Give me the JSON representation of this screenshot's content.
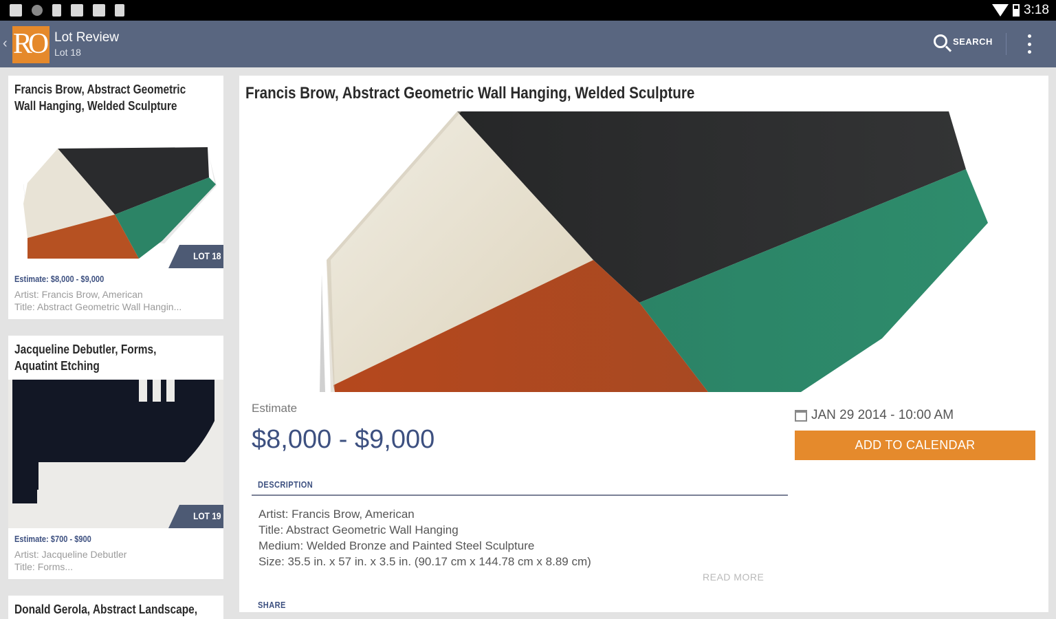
{
  "status_bar": {
    "time": "3:18"
  },
  "action_bar": {
    "logo_text": "RO",
    "title": "Lot Review",
    "subtitle": "Lot 18",
    "search_label": "SEARCH"
  },
  "lots": [
    {
      "title_line1": "Francis Brow, Abstract Geometric",
      "title_line2": "Wall Hanging, Welded Sculpture",
      "badge": "LOT 18",
      "estimate": "Estimate: $8,000 - $9,000",
      "artist": "Artist:  Francis Brow, American",
      "title_meta": "Title:  Abstract Geometric Wall Hangin..."
    },
    {
      "title_line1": "Jacqueline Debutler, Forms,",
      "title_line2": "Aquatint Etching",
      "badge": "LOT 19",
      "estimate": "Estimate: $700 - $900",
      "artist": "Artist:  Jacqueline Debutler",
      "title_meta": "Title:  Forms..."
    },
    {
      "title_line1": "Donald Gerola, Abstract Landscape,"
    }
  ],
  "detail": {
    "title": "Francis Brow, Abstract Geometric Wall Hanging, Welded Sculpture",
    "estimate_label": "Estimate",
    "estimate_value": "$8,000 - $9,000",
    "description_heading": "DESCRIPTION",
    "description_lines": [
      "Artist:  Francis Brow, American",
      "Title:  Abstract Geometric Wall Hanging",
      "Medium:  Welded Bronze and Painted Steel Sculpture",
      "Size:  35.5 in. x 57 in. x 3.5 in. (90.17 cm x 144.78 cm x 8.89 cm)"
    ],
    "read_more": "READ MORE",
    "share_heading": "SHARE",
    "date": "JAN 29 2014 - 10:00 AM",
    "calendar_button": "ADD TO CALENDAR"
  },
  "colors": {
    "action_bar": "#596680",
    "accent_orange": "#e5892b",
    "price_blue": "#3d5080"
  },
  "icons": [
    "back-chevron-icon",
    "search-icon",
    "overflow-menu-icon",
    "calendar-icon",
    "wifi-icon",
    "battery-icon"
  ]
}
